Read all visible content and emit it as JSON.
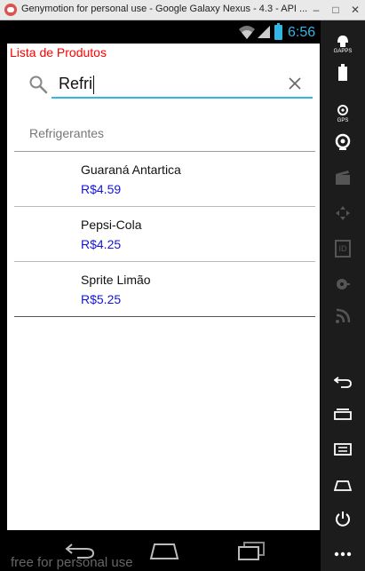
{
  "window": {
    "title": "Genymotion for personal use - Google Galaxy Nexus - 4.3 - API ..."
  },
  "statusbar": {
    "time": "6:56",
    "accent": "#33b5e5"
  },
  "app": {
    "title": "Lista de Produtos",
    "title_color": "#ff0000",
    "search": {
      "value": "Refri",
      "placeholder": ""
    },
    "section_header": "Refrigerantes",
    "products": [
      {
        "name": "Guaraná Antartica",
        "price": "R$4.59"
      },
      {
        "name": "Pepsi-Cola",
        "price": "R$4.25"
      },
      {
        "name": "Sprite Limão",
        "price": "R$5.25"
      }
    ],
    "price_color": "#1515d6"
  },
  "sidepanel": {
    "items": [
      {
        "icon": "gapps-icon",
        "label": "GAPPS"
      },
      {
        "icon": "battery-icon",
        "label": ""
      },
      {
        "icon": "gps-icon",
        "label": "GPS"
      },
      {
        "icon": "webcam-icon",
        "label": ""
      },
      {
        "icon": "video-icon",
        "label": ""
      },
      {
        "icon": "remote-control-icon",
        "label": ""
      },
      {
        "icon": "id-icon",
        "label": "ID"
      },
      {
        "icon": "disk-icon",
        "label": ""
      },
      {
        "icon": "rss-icon",
        "label": ""
      },
      {
        "icon": "back-icon",
        "label": ""
      },
      {
        "icon": "recent-apps-icon",
        "label": ""
      },
      {
        "icon": "menu-icon",
        "label": ""
      },
      {
        "icon": "home-icon",
        "label": ""
      },
      {
        "icon": "power-icon",
        "label": ""
      },
      {
        "icon": "more-icon",
        "label": ""
      }
    ]
  },
  "watermark": "free for personal use"
}
